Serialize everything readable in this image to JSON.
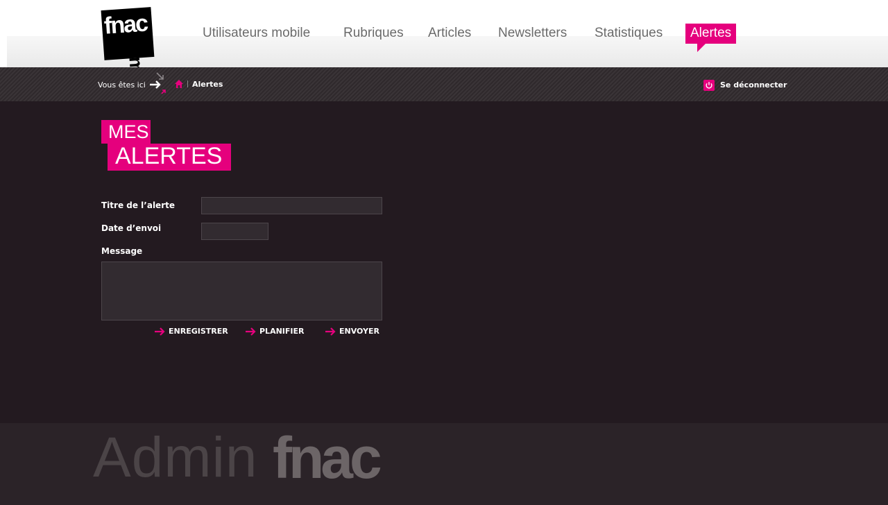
{
  "colors": {
    "accent": "#e5007d",
    "background": "#231a20",
    "header": "#ffffff",
    "nav_text": "#6a6a6a"
  },
  "logo": {
    "text": "fnac",
    "suffix": ".com"
  },
  "nav": {
    "items": [
      {
        "label": "Utilisateurs mobile"
      },
      {
        "label": "Rubriques"
      },
      {
        "label": "Articles"
      },
      {
        "label": "Newsletters"
      },
      {
        "label": "Statistiques"
      },
      {
        "label": "Alertes",
        "active": true
      }
    ]
  },
  "breadcrumb": {
    "here_label": "Vous êtes ici",
    "home_icon": "home-icon",
    "current": "Alertes"
  },
  "logout": {
    "label": "Se déconnecter",
    "icon": "power-icon"
  },
  "page_title": {
    "line1": "MES",
    "line2": "ALERTES"
  },
  "form": {
    "title_label": "Titre de l’alerte",
    "title_value": "",
    "date_label": "Date d’envoi",
    "date_value": "",
    "message_label": "Message",
    "message_value": ""
  },
  "actions": [
    {
      "label": "ENREGISTRER",
      "icon": "arrow-right-icon"
    },
    {
      "label": "PLANIFIER",
      "icon": "arrow-right-icon"
    },
    {
      "label": "ENVOYER",
      "icon": "arrow-right-icon"
    }
  ],
  "footer": {
    "brand_light": "Admin",
    "brand_bold": "fnac"
  }
}
